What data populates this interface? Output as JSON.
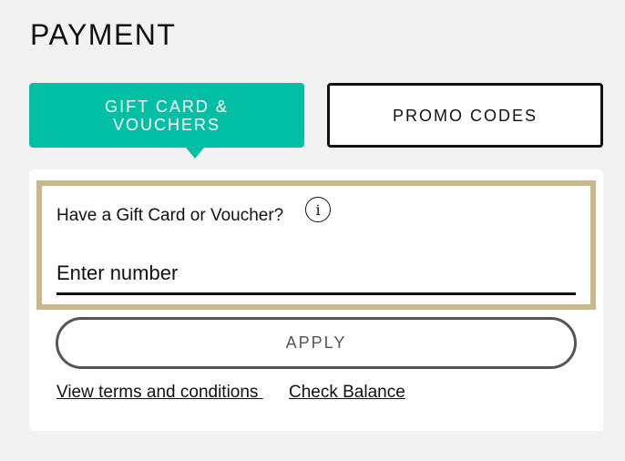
{
  "page": {
    "title": "PAYMENT"
  },
  "tabs": [
    {
      "label_line1": "GIFT CARD &",
      "label_line2": "VOUCHERS",
      "active": true
    },
    {
      "label": "PROMO CODES",
      "active": false
    }
  ],
  "gift_card": {
    "label": "Have a Gift Card or Voucher?",
    "info_icon": "i",
    "input_placeholder": "Enter number",
    "apply_label": "APPLY",
    "terms_link": "View terms and conditions ",
    "balance_link": "Check Balance"
  },
  "colors": {
    "accent": "#00bfa5",
    "field_border": "#c9b98a"
  }
}
